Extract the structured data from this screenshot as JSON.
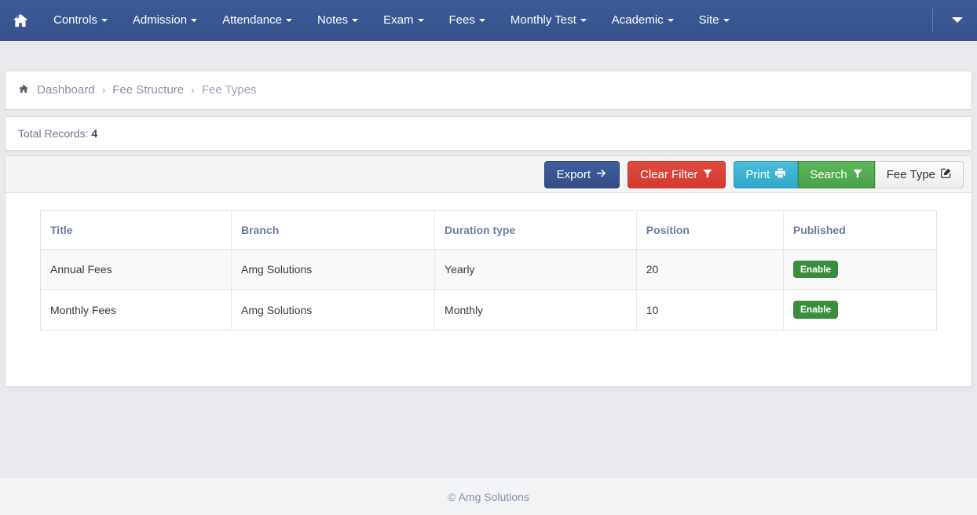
{
  "navbar": {
    "home_icon": "home-icon",
    "items": [
      {
        "label": "Controls",
        "has_caret": true
      },
      {
        "label": "Admission",
        "has_caret": true
      },
      {
        "label": "Attendance",
        "has_caret": true
      },
      {
        "label": "Notes",
        "has_caret": true
      },
      {
        "label": "Exam",
        "has_caret": true
      },
      {
        "label": "Fees",
        "has_caret": true
      },
      {
        "label": "Monthly Test",
        "has_caret": true
      },
      {
        "label": "Academic",
        "has_caret": true
      },
      {
        "label": "Site",
        "has_caret": true
      }
    ],
    "toggle_icon": "caret-down-icon",
    "background_color": "#3a5795"
  },
  "breadcrumb": {
    "home_icon": "home-icon",
    "items": [
      {
        "label": "Dashboard",
        "active": false
      },
      {
        "label": "Fee Structure",
        "active": false
      },
      {
        "label": "Fee Types",
        "active": true
      }
    ],
    "separator": "›"
  },
  "records": {
    "label": "Total Records:",
    "count": "4"
  },
  "toolbar": {
    "export_label": "Export",
    "export_icon": "arrow-right-icon",
    "clear_filter_label": "Clear Filter",
    "clear_filter_icon": "filter-icon",
    "print_label": "Print",
    "print_icon": "printer-icon",
    "search_label": "Search",
    "search_icon": "filter-icon",
    "fee_type_label": "Fee Type",
    "fee_type_icon": "edit-pencil-square-icon"
  },
  "table": {
    "columns": [
      "Title",
      "Branch",
      "Duration type",
      "Position",
      "Published"
    ],
    "rows": [
      {
        "title": "Annual Fees",
        "branch": "Amg Solutions",
        "duration": "Yearly",
        "position": "20",
        "published": "Enable"
      },
      {
        "title": "Monthly Fees",
        "branch": "Amg Solutions",
        "duration": "Monthly",
        "position": "10",
        "published": "Enable"
      }
    ]
  },
  "footer": {
    "text": "© Amg Solutions"
  },
  "colors": {
    "navbar": "#3a5795",
    "export": "#36508c",
    "clear_filter": "#d9534f",
    "print": "#3cb4d8",
    "search": "#4fb04f",
    "badge_enable": "#3c8c40",
    "header_text": "#6c7ba5"
  }
}
